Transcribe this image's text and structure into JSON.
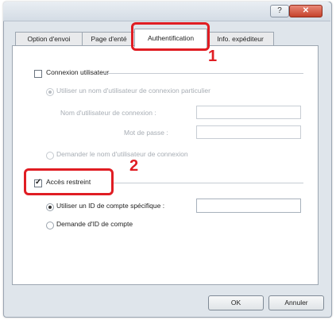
{
  "window": {
    "title_buttons": {
      "help_icon": "?",
      "close_icon": "✕"
    }
  },
  "tabs": [
    {
      "label": "Option d'envoi"
    },
    {
      "label": "Page d'enté"
    },
    {
      "label": "Authentification"
    },
    {
      "label": "Info. expéditeur"
    }
  ],
  "auth": {
    "user_login_label": "Connexion utilisateur",
    "use_specific_name_label": "Utiliser un nom d'utilisateur de connexion particulier",
    "login_name_label": "Nom d'utilisateur de connexion :",
    "password_label": "Mot de passe :",
    "ask_name_label": "Demander le nom d'utilisateur de connexion",
    "restricted_access_label": "Accès restreint",
    "use_account_id_label": "Utiliser un ID de compte spécifique :",
    "ask_account_id_label": "Demande d'ID de compte",
    "account_id_value": ""
  },
  "buttons": {
    "ok": "OK",
    "cancel": "Annuler"
  },
  "callouts": {
    "one": "1",
    "two": "2",
    "color": "#e01d23"
  }
}
